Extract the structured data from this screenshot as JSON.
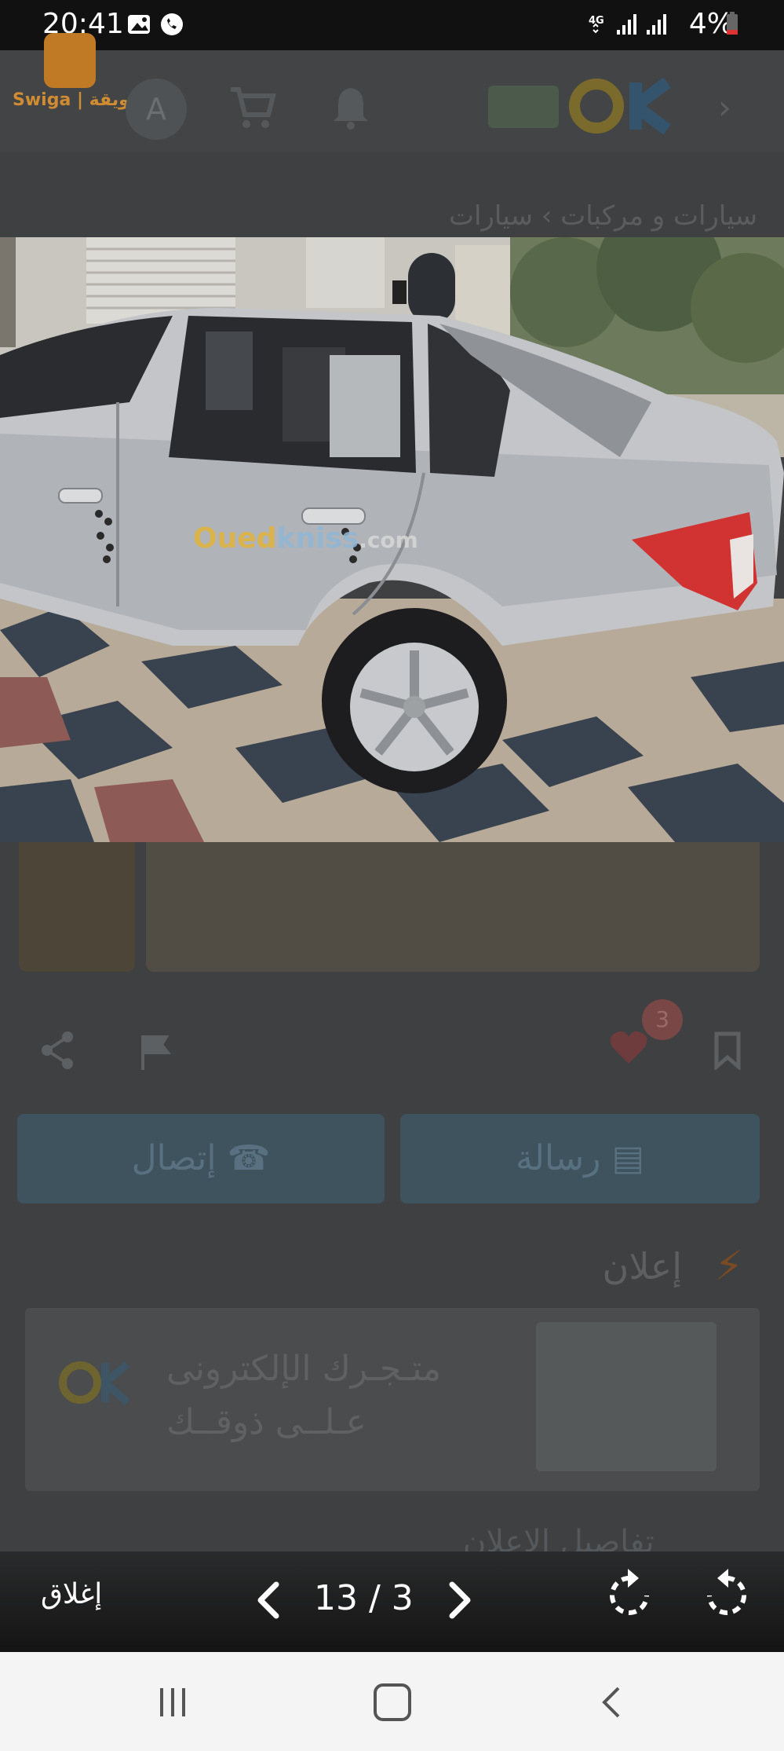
{
  "status_bar": {
    "time": "20:41",
    "network": "4G",
    "battery": "4%"
  },
  "background_page": {
    "brand": "Swiga | سويقة",
    "avatar_letter": "A",
    "breadcrumb": "سيارات و مركبات  ›  سيارات",
    "likes_count": "3",
    "call_button": "إتصال",
    "message_button": "رسالة",
    "ad_section_title": "إعلان",
    "banner_line1": "متـجـرك الإلكترونى",
    "banner_line2": "عـلــى ذوقــك",
    "details_title": "تفاصيل الإعلان"
  },
  "photo": {
    "watermark": "Ouedkniss.com"
  },
  "viewer": {
    "close_label": "إغلاق",
    "counter": "13 / 3"
  },
  "colors": {
    "accent_blue": "#3e535e",
    "viewer_bar": "#141414",
    "nav_bar": "#f4f4f4"
  }
}
